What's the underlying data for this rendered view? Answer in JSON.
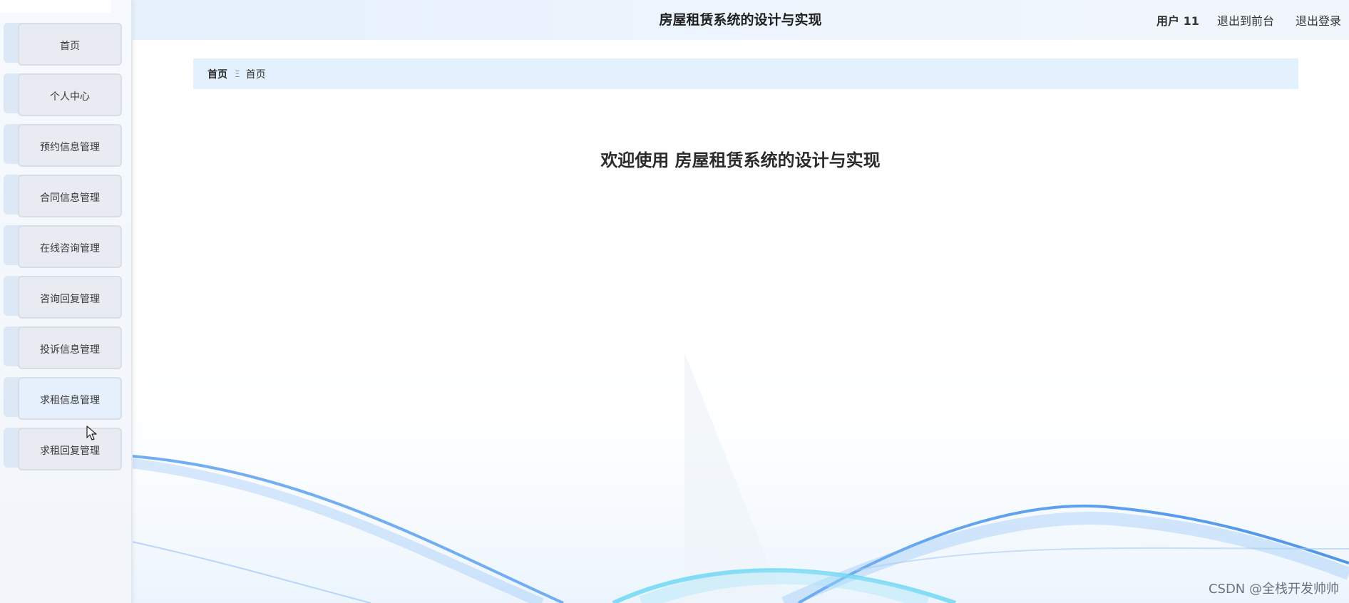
{
  "app": {
    "title": "房屋租赁系统的设计与实现"
  },
  "header": {
    "user_label": "用户 11",
    "back_to_front_label": "退出到前台",
    "logout_label": "退出登录"
  },
  "sidebar": {
    "items": [
      {
        "label": "首页"
      },
      {
        "label": "个人中心"
      },
      {
        "label": "预约信息管理"
      },
      {
        "label": "合同信息管理"
      },
      {
        "label": "在线咨询管理"
      },
      {
        "label": "咨询回复管理"
      },
      {
        "label": "投诉信息管理"
      },
      {
        "label": "求租信息管理"
      },
      {
        "label": "求租回复管理"
      }
    ]
  },
  "breadcrumb": {
    "home": "首页",
    "separator": "Ξ",
    "current": "首页"
  },
  "main": {
    "welcome": "欢迎使用 房屋租赁系统的设计与实现"
  },
  "watermark": {
    "text": "CSDN @全栈开发帅帅"
  },
  "colors": {
    "header_bg": "#e6f1fd",
    "breadcrumb_bg": "#e3f0fd",
    "menu_face": "#e8ecf2",
    "wave_blue": "#5aa0f0",
    "wave_cyan": "#5fd4f2"
  }
}
